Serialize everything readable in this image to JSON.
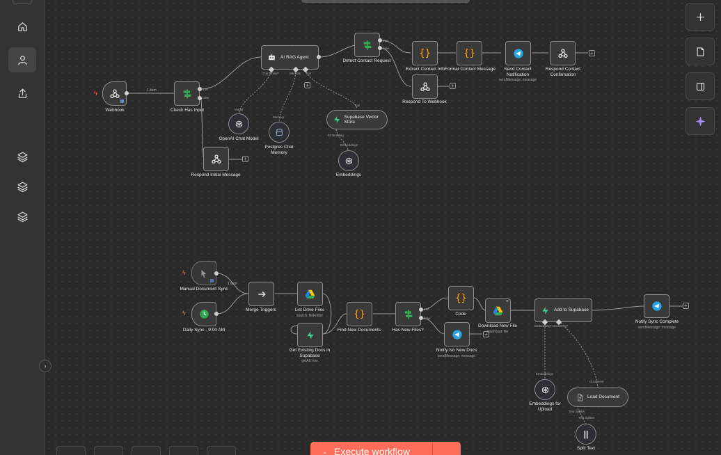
{
  "canvas": {
    "workflow1": {
      "webhook": "Webhook",
      "check_has_input": "Check Has Input",
      "ai_rag_agent": "AI RAG Agent",
      "detect_contact_request": "Detect Contact Request",
      "extract_contact_info": "Extract Contact Info",
      "format_contact_message": "Format Contact Message",
      "send_contact_notification": "Send Contact Notification",
      "send_contact_notification_sub": "sendMessage: message",
      "respond_contact_confirmation": "Respond Contact Confirmation",
      "respond_to_webhook": "Respond To Webhook",
      "openai_chat_model": "OpenAI Chat Model",
      "postgres_chat_memory": "Postgres Chat Memory",
      "supabase_vector_store": "Supabase Vector Store",
      "embeddings": "Embeddings",
      "respond_initial_message": "Respond Initial Message",
      "edge_1_item": "1 item",
      "port_true": "true",
      "port_false": "false",
      "port_chat_model": "Chat Model*",
      "port_memory": "Memory",
      "port_tool": "Tool",
      "port_model": "Model",
      "port_tool_sub": "Tool",
      "port_embedding": "Embedding",
      "port_embeddings": "Embeddings"
    },
    "workflow2": {
      "manual_document_sync": "Manual Document Sync",
      "daily_sync": "Daily Sync - 9:00 AM",
      "merge_triggers": "Merge Triggers",
      "list_drive_files": "List Drive Files",
      "list_drive_files_sub": "search: fileFolder",
      "get_existing_docs": "Get Existing Docs in Supabase",
      "get_existing_docs_sub": "getAll: row",
      "find_new_documents": "Find New Documents",
      "has_new_files": "Has New Files?",
      "code": "Code",
      "download_new_file": "Download New File",
      "download_new_file_sub": "download: file",
      "notify_no_new_docs": "Notify No New Docs",
      "notify_no_new_docs_sub": "sendMessage: message",
      "add_to_supabase": "Add to Supabase",
      "notify_sync_complete": "Notify Sync Complete",
      "notify_sync_complete_sub": "sendMessage: message",
      "embeddings_for_upload": "Embeddings for Upload",
      "load_document": "Load Document",
      "split_text": "Split Text",
      "edge_1_item": "1 item",
      "port_true": "true",
      "port_false": "false",
      "port_embedding": "Embedding*",
      "port_document": "Document*",
      "port_embeddings": "Embeddings",
      "port_document_sub": "Document",
      "port_text_splitter": "Text Splitter",
      "port_text_splitter_sub": "Text Splitter"
    }
  },
  "toolbar": {
    "execute_label": "Execute workflow"
  },
  "icons": {
    "sidebar": [
      "home-icon",
      "user-icon",
      "share-icon",
      "layers-icon",
      "layers-icon",
      "layers-icon"
    ],
    "right": [
      "plus-icon",
      "sticky-note-icon",
      "panel-icon",
      "sparkle-icon"
    ]
  },
  "colors": {
    "accent": "#ff6d5a",
    "code_orange": "#f0a020",
    "supabase_green": "#3ecf8e",
    "telegram_blue": "#2aa3e0",
    "if_green": "#35a853"
  }
}
